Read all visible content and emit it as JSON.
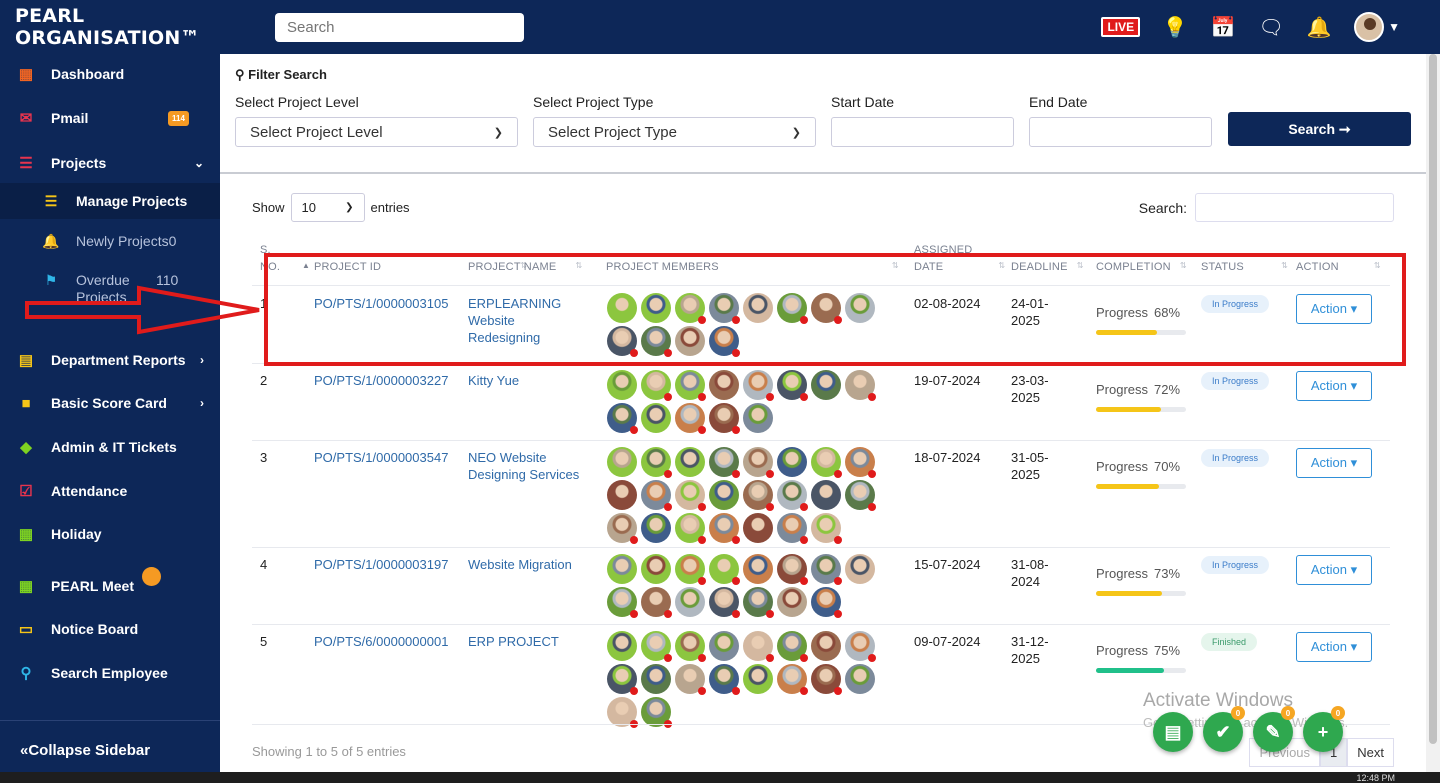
{
  "header": {
    "brand": "PEARL ORGANISATION™",
    "search_placeholder": "Search",
    "live_label": "LIVE"
  },
  "sidebar": {
    "items": [
      {
        "label": "Dashboard",
        "icon": "dashboard-icon"
      },
      {
        "label": "Pmail",
        "icon": "mail-icon",
        "badge": "114"
      },
      {
        "label": "Projects",
        "icon": "layers-icon"
      },
      {
        "label": "Manage Projects",
        "icon": "list-icon"
      },
      {
        "label": "Newly Projects",
        "icon": "bell-icon",
        "badge": "0"
      },
      {
        "label": "Overdue Projects",
        "icon": "flag-icon",
        "badge": "110"
      },
      {
        "label": "Department Reports",
        "icon": "bar-chart-icon"
      },
      {
        "label": "Basic Score Card",
        "icon": "folder-icon"
      },
      {
        "label": "Admin & IT Tickets",
        "icon": "ticket-icon"
      },
      {
        "label": "Attendance",
        "icon": "calendar-check-icon"
      },
      {
        "label": "Holiday",
        "icon": "calendar-icon"
      },
      {
        "label": "PEARL Meet",
        "icon": "meet-icon"
      },
      {
        "label": "Notice Board",
        "icon": "laptop-icon"
      },
      {
        "label": "Search Employee",
        "icon": "search-icon"
      }
    ],
    "collapse_label": "Collapse Sidebar"
  },
  "filter": {
    "title": "Filter Search",
    "level_label": "Select Project Level",
    "level_value": "Select Project Level",
    "type_label": "Select Project Type",
    "type_value": "Select Project Type",
    "start_label": "Start Date",
    "end_label": "End Date",
    "search_button": "Search ➞"
  },
  "table_controls": {
    "show_label": "Show",
    "entries_value": "10",
    "entries_label": "entries",
    "search_label": "Search:"
  },
  "columns": {
    "sno_top": "S.",
    "sno": "NO.",
    "project_id": "PROJECT ID",
    "project_name": "PROJECT NAME",
    "members": "PROJECT MEMBERS",
    "assigned_top": "ASSIGNED",
    "assigned": "DATE",
    "deadline": "DEADLINE",
    "completion": "COMPLETION",
    "status": "STATUS",
    "action": "ACTION"
  },
  "rows": [
    {
      "no": "1",
      "id": "PO/PTS/1/0000003105",
      "name": "ERPLEARNING Website Redesigning",
      "assigned": "02-08-2024",
      "deadline": "24-01-2025",
      "progress_label": "Progress",
      "progress": "68%",
      "progress_value": 68,
      "status": "In Progress",
      "action": "Action ▾",
      "members": 12
    },
    {
      "no": "2",
      "id": "PO/PTS/1/0000003227",
      "name": "Kitty Yue",
      "assigned": "19-07-2024",
      "deadline": "23-03-2025",
      "progress_label": "Progress",
      "progress": "72%",
      "progress_value": 72,
      "status": "In Progress",
      "action": "Action ▾",
      "members": 13
    },
    {
      "no": "3",
      "id": "PO/PTS/1/0000003547",
      "name": "NEO Website Designing Services",
      "assigned": "18-07-2024",
      "deadline": "31-05-2025",
      "progress_label": "Progress",
      "progress": "70%",
      "progress_value": 70,
      "status": "In Progress",
      "action": "Action ▾",
      "members": 23
    },
    {
      "no": "4",
      "id": "PO/PTS/1/0000003197",
      "name": "Website Migration",
      "assigned": "15-07-2024",
      "deadline": "31-08-2024",
      "progress_label": "Progress",
      "progress": "73%",
      "progress_value": 73,
      "status": "In Progress",
      "action": "Action ▾",
      "members": 15
    },
    {
      "no": "5",
      "id": "PO/PTS/6/0000000001",
      "name": "ERP PROJECT",
      "assigned": "09-07-2024",
      "deadline": "31-12-2025",
      "progress_label": "Progress",
      "progress": "75%",
      "progress_value": 75,
      "status": "Finished",
      "action": "Action ▾",
      "members": 18
    }
  ],
  "footer": {
    "info": "Showing 1 to 5 of 5 entries",
    "previous": "Previous",
    "page": "1",
    "next": "Next"
  },
  "watermark": {
    "line1": "Activate Windows",
    "line2": "Go to Settings to activate Windows."
  },
  "fab_badges": [
    "0",
    "0",
    "0"
  ],
  "taskbar_clock": "12:48 PM",
  "colors": {
    "navy": "#0d2758",
    "progress_yellow": "#f5c518",
    "progress_green": "#20c08a",
    "annotation_red": "#e01b1b"
  }
}
